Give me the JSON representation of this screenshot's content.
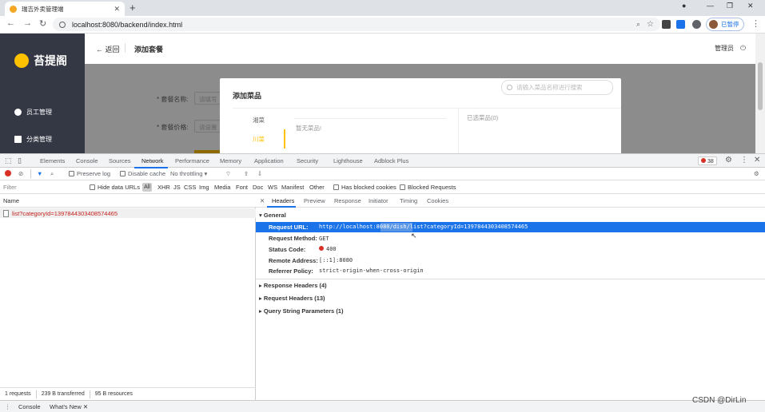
{
  "browser": {
    "tab_title": "瑞吉外卖管理端",
    "url": "localhost:8080/backend/index.html",
    "profile_label": "已暂停"
  },
  "app": {
    "logo_text": "苔提阁",
    "sidebar": [
      {
        "label": "员工管理",
        "icon": "info-icon"
      },
      {
        "label": "分类管理",
        "icon": "grid-icon"
      }
    ],
    "back_label": "返回",
    "page_title": "添加套餐",
    "user_label": "管理员",
    "form": {
      "name_label": "* 套餐名称:",
      "name_placeholder": "请填写",
      "price_label": "* 套餐价格:",
      "price_placeholder": "请设置"
    },
    "dialog": {
      "title": "添加菜品",
      "search_placeholder": "请输入菜品名称进行搜索",
      "categories": [
        "湘菜",
        "川菜"
      ],
      "active_category": "川菜",
      "empty_text": "暂无菜品!",
      "selected_label": "已选菜品(0)"
    }
  },
  "devtools": {
    "tabs": [
      "Elements",
      "Console",
      "Sources",
      "Network",
      "Performance",
      "Memory",
      "Application",
      "Security",
      "Lighthouse",
      "Adblock Plus"
    ],
    "active_tab": "Network",
    "error_count": "38",
    "controls": {
      "preserve_log": "Preserve log",
      "disable_cache": "Disable cache",
      "throttling": "No throttling"
    },
    "filter": {
      "placeholder": "Filter",
      "hide_data_urls": "Hide data URLs",
      "types": [
        "All",
        "XHR",
        "JS",
        "CSS",
        "Img",
        "Media",
        "Font",
        "Doc",
        "WS",
        "Manifest",
        "Other"
      ],
      "has_blocked_cookies": "Has blocked cookies",
      "blocked_requests": "Blocked Requests"
    },
    "name_header": "Name",
    "request_name": "list?categoryId=1397844303408574465",
    "status": {
      "requests": "1 requests",
      "transferred": "239 B transferred",
      "resources": "95 B resources"
    },
    "detail_tabs": [
      "Headers",
      "Preview",
      "Response",
      "Initiator",
      "Timing",
      "Cookies"
    ],
    "general_title": "General",
    "general": {
      "request_url_label": "Request URL:",
      "request_url": "http://localhost:8080/dish/list?categoryId=1397844303408574465",
      "method_label": "Request Method:",
      "method": "GET",
      "status_label": "Status Code:",
      "status_code": "400",
      "remote_label": "Remote Address:",
      "remote": "[::1]:8080",
      "referrer_label": "Referrer Policy:",
      "referrer": "strict-origin-when-cross-origin"
    },
    "sections": [
      "Response Headers (4)",
      "Request Headers (13)",
      "Query String Parameters (1)"
    ],
    "drawer": [
      "Console",
      "What's New"
    ]
  },
  "watermark": "CSDN @DirLin"
}
